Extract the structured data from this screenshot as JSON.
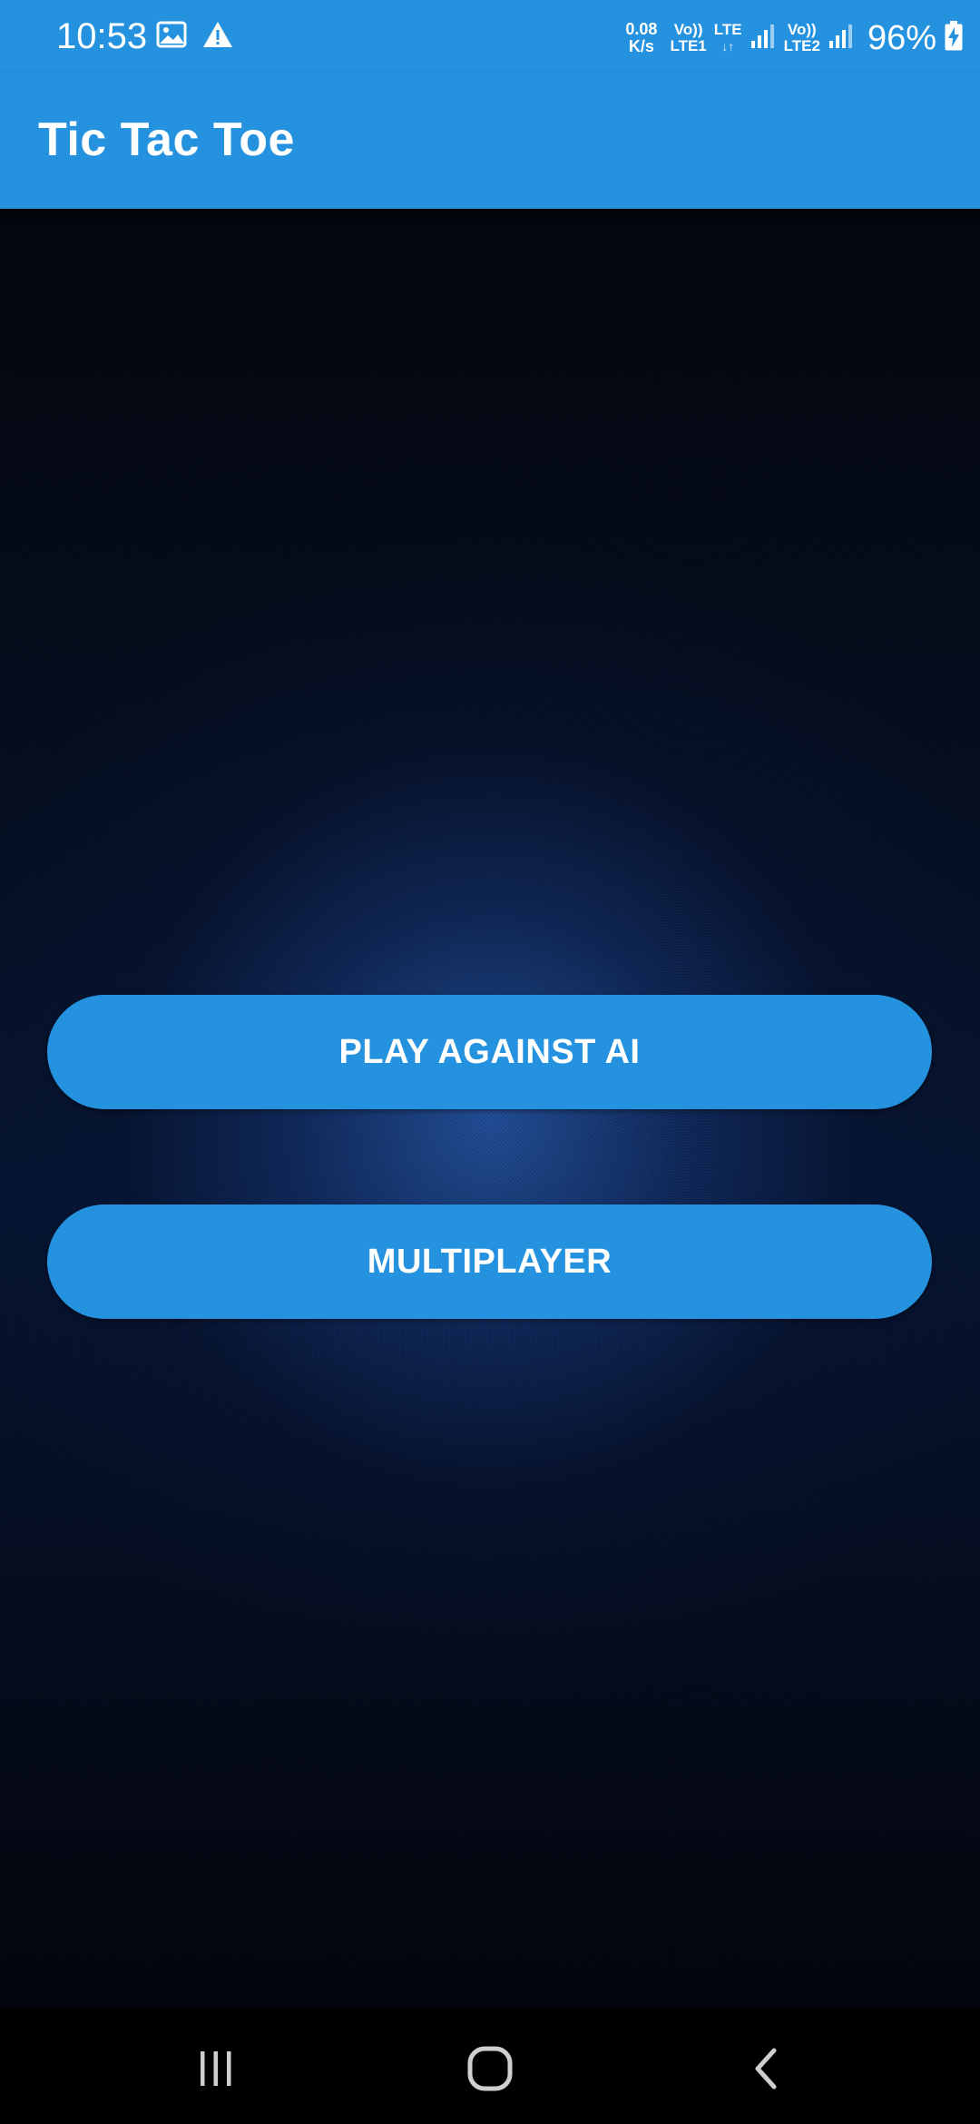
{
  "status_bar": {
    "time": "10:53",
    "left_icons": [
      "image-icon",
      "warning-icon"
    ],
    "net_speed_value": "0.08",
    "net_speed_unit": "K/s",
    "sim1_top": "Vo))",
    "sim1_bottom": "LTE1",
    "data_type_top": "LTE",
    "data_type_bottom": "↓↑",
    "sim2_top": "Vo))",
    "sim2_bottom": "LTE2",
    "battery_percent": "96%"
  },
  "app_bar": {
    "title": "Tic Tac Toe"
  },
  "menu": {
    "play_ai_label": "PLAY AGAINST AI",
    "multiplayer_label": "MULTIPLAYER"
  },
  "nav_bar": {
    "icons": [
      "recent-apps-icon",
      "home-icon",
      "back-icon"
    ]
  },
  "colors": {
    "primary": "#2592e0",
    "background_dark": "#03060d",
    "background_glow": "#285aaa",
    "text_on_primary": "#ffffff"
  }
}
